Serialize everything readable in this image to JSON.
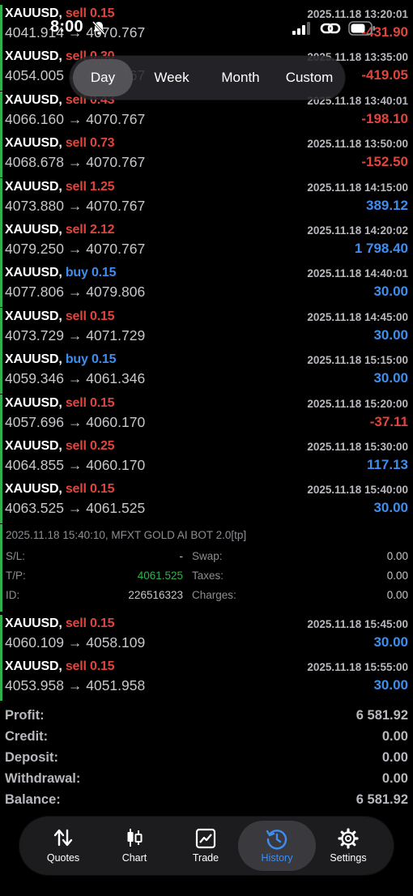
{
  "status_bar": {
    "time": "8:00"
  },
  "period_tabs": [
    "Day",
    "Week",
    "Month",
    "Custom"
  ],
  "period_selected": "Day",
  "trades": [
    {
      "symbol": "XAUUSD,",
      "side": "sell",
      "volume": "0.15",
      "open": "4041.914",
      "close": "4070.767",
      "time": "2025.11.18 13:20:01",
      "profit": "-431.90",
      "dir": "neg"
    },
    {
      "symbol": "XAUUSD,",
      "side": "sell",
      "volume": "0.30",
      "open": "4054.005",
      "close": "4070.767",
      "time": "2025.11.18 13:35:00",
      "profit": "-419.05",
      "dir": "neg"
    },
    {
      "symbol": "XAUUSD,",
      "side": "sell",
      "volume": "0.43",
      "open": "4066.160",
      "close": "4070.767",
      "time": "2025.11.18 13:40:01",
      "profit": "-198.10",
      "dir": "neg"
    },
    {
      "symbol": "XAUUSD,",
      "side": "sell",
      "volume": "0.73",
      "open": "4068.678",
      "close": "4070.767",
      "time": "2025.11.18 13:50:00",
      "profit": "-152.50",
      "dir": "neg"
    },
    {
      "symbol": "XAUUSD,",
      "side": "sell",
      "volume": "1.25",
      "open": "4073.880",
      "close": "4070.767",
      "time": "2025.11.18 14:15:00",
      "profit": "389.12",
      "dir": "pos"
    },
    {
      "symbol": "XAUUSD,",
      "side": "sell",
      "volume": "2.12",
      "open": "4079.250",
      "close": "4070.767",
      "time": "2025.11.18 14:20:02",
      "profit": "1 798.40",
      "dir": "pos"
    },
    {
      "symbol": "XAUUSD,",
      "side": "buy",
      "volume": "0.15",
      "open": "4077.806",
      "close": "4079.806",
      "time": "2025.11.18 14:40:01",
      "profit": "30.00",
      "dir": "pos"
    },
    {
      "symbol": "XAUUSD,",
      "side": "sell",
      "volume": "0.15",
      "open": "4073.729",
      "close": "4071.729",
      "time": "2025.11.18 14:45:00",
      "profit": "30.00",
      "dir": "pos"
    },
    {
      "symbol": "XAUUSD,",
      "side": "buy",
      "volume": "0.15",
      "open": "4059.346",
      "close": "4061.346",
      "time": "2025.11.18 15:15:00",
      "profit": "30.00",
      "dir": "pos"
    },
    {
      "symbol": "XAUUSD,",
      "side": "sell",
      "volume": "0.15",
      "open": "4057.696",
      "close": "4060.170",
      "time": "2025.11.18 15:20:00",
      "profit": "-37.11",
      "dir": "neg"
    },
    {
      "symbol": "XAUUSD,",
      "side": "sell",
      "volume": "0.25",
      "open": "4064.855",
      "close": "4060.170",
      "time": "2025.11.18 15:30:00",
      "profit": "117.13",
      "dir": "pos"
    },
    {
      "symbol": "XAUUSD,",
      "side": "sell",
      "volume": "0.15",
      "open": "4063.525",
      "close": "4061.525",
      "time": "2025.11.18 15:40:00",
      "profit": "30.00",
      "dir": "pos"
    }
  ],
  "detail": {
    "comment": "2025.11.18 15:40:10, MFXT GOLD AI BOT 2.0[tp]",
    "sl_label": "S/L:",
    "sl_value": "-",
    "tp_label": "T/P:",
    "tp_value": "4061.525",
    "id_label": "ID:",
    "id_value": "226516323",
    "swap_label": "Swap:",
    "swap_value": "0.00",
    "taxes_label": "Taxes:",
    "taxes_value": "0.00",
    "charges_label": "Charges:",
    "charges_value": "0.00"
  },
  "trades_after": [
    {
      "symbol": "XAUUSD,",
      "side": "sell",
      "volume": "0.15",
      "open": "4060.109",
      "close": "4058.109",
      "time": "2025.11.18 15:45:00",
      "profit": "30.00",
      "dir": "pos"
    },
    {
      "symbol": "XAUUSD,",
      "side": "sell",
      "volume": "0.15",
      "open": "4053.958",
      "close": "4051.958",
      "time": "2025.11.18 15:55:00",
      "profit": "30.00",
      "dir": "pos"
    }
  ],
  "summary": [
    {
      "label": "Profit:",
      "value": "6 581.92"
    },
    {
      "label": "Credit:",
      "value": "0.00"
    },
    {
      "label": "Deposit:",
      "value": "0.00"
    },
    {
      "label": "Withdrawal:",
      "value": "0.00"
    },
    {
      "label": "Balance:",
      "value": "6 581.92"
    }
  ],
  "tabbar": [
    {
      "label": "Quotes",
      "icon": "quotes-arrows-icon"
    },
    {
      "label": "Chart",
      "icon": "candlestick-icon"
    },
    {
      "label": "Trade",
      "icon": "trade-chart-icon"
    },
    {
      "label": "History",
      "icon": "history-clock-icon",
      "active": true
    },
    {
      "label": "Settings",
      "icon": "gear-icon"
    }
  ],
  "colors": {
    "sell": "#e0453d",
    "buy": "#3d8ef0",
    "positive": "#3d8ef0",
    "negative": "#e0453d",
    "tp": "#2fb24c",
    "accent": "#3d8ef0"
  }
}
